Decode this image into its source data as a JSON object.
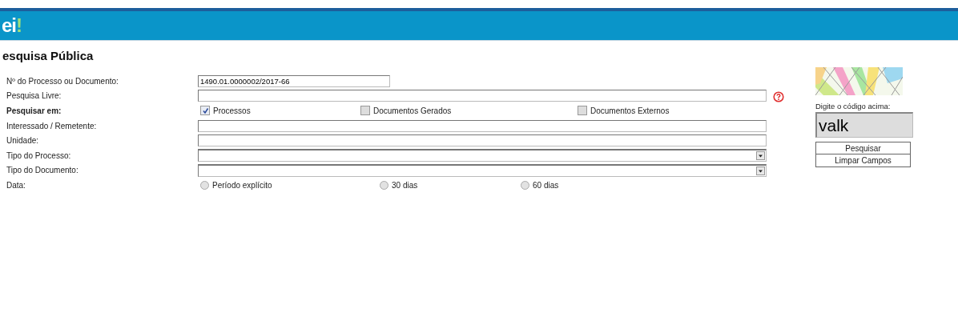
{
  "header": {
    "logo": "ei",
    "logo_mark": "!"
  },
  "title": "esquisa Pública",
  "form": [
    {
      "kind": "short-text",
      "label": "Nº do Processo ou Documento:",
      "value": "1490.01.0000002/2017-66"
    },
    {
      "kind": "text-help",
      "label": "Pesquisa Livre:"
    },
    {
      "kind": "checks",
      "label": "Pesquisar em:",
      "options": [
        {
          "label": "Processos",
          "checked": true
        },
        {
          "label": "Documentos Gerados",
          "checked": false
        },
        {
          "label": "Documentos Externos",
          "checked": false
        }
      ]
    },
    {
      "kind": "text",
      "label": "Interessado / Remetente:"
    },
    {
      "kind": "text",
      "label": "Unidade:"
    },
    {
      "kind": "select",
      "label": "Tipo do Processo:"
    },
    {
      "kind": "select",
      "label": "Tipo do Documento:"
    },
    {
      "kind": "radios",
      "label": "Data:",
      "options": [
        {
          "label": "Período explícito",
          "selected": false
        },
        {
          "label": "30 dias",
          "selected": false
        },
        {
          "label": "60 dias",
          "selected": false
        }
      ]
    }
  ],
  "captcha": {
    "prompt": "Digite o código acima:",
    "value": "valk"
  },
  "buttons": [
    "Pesquisar",
    "Limpar Campos"
  ]
}
